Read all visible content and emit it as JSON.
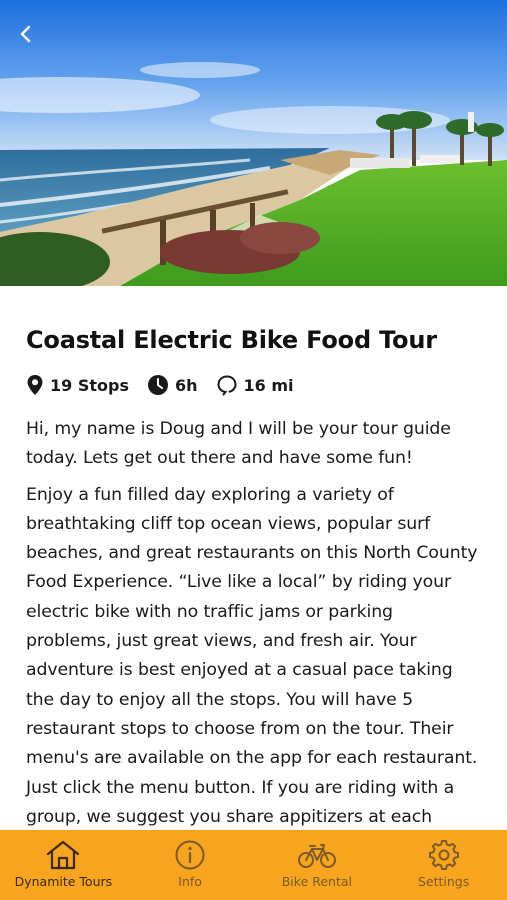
{
  "header": {
    "back_icon": "chevron-left-icon"
  },
  "tour": {
    "title": "Coastal Electric Bike Food Tour",
    "stops": "19 Stops",
    "duration": "6h",
    "distance": "16 mi",
    "intro": "Hi, my name is Doug and I will be your tour guide today. Lets get out there and have some fun!",
    "description": "Enjoy a fun filled day exploring a variety of breathtaking cliff top ocean views, popular surf beaches, and great restaurants on this North County Food Experience. “Live like a local” by riding your electric bike with no traffic jams or parking problems, just great views, and fresh air. Your adventure is best enjoyed at a casual pace taking the day to enjoy all the stops. You will have 5 restaurant stops to choose from on the tour. Their menu's are available on the app for each restaurant. Just click the menu button. If you are riding with a group, we suggest you share appitizers at each"
  },
  "tabbar": {
    "accent": "#f7a51f",
    "tabs": [
      {
        "label": "Dynamite Tours",
        "icon": "home-icon",
        "active": true
      },
      {
        "label": "Info",
        "icon": "info-icon",
        "active": false
      },
      {
        "label": "Bike Rental",
        "icon": "bicycle-icon",
        "active": false
      },
      {
        "label": "Settings",
        "icon": "gear-icon",
        "active": false
      }
    ]
  }
}
